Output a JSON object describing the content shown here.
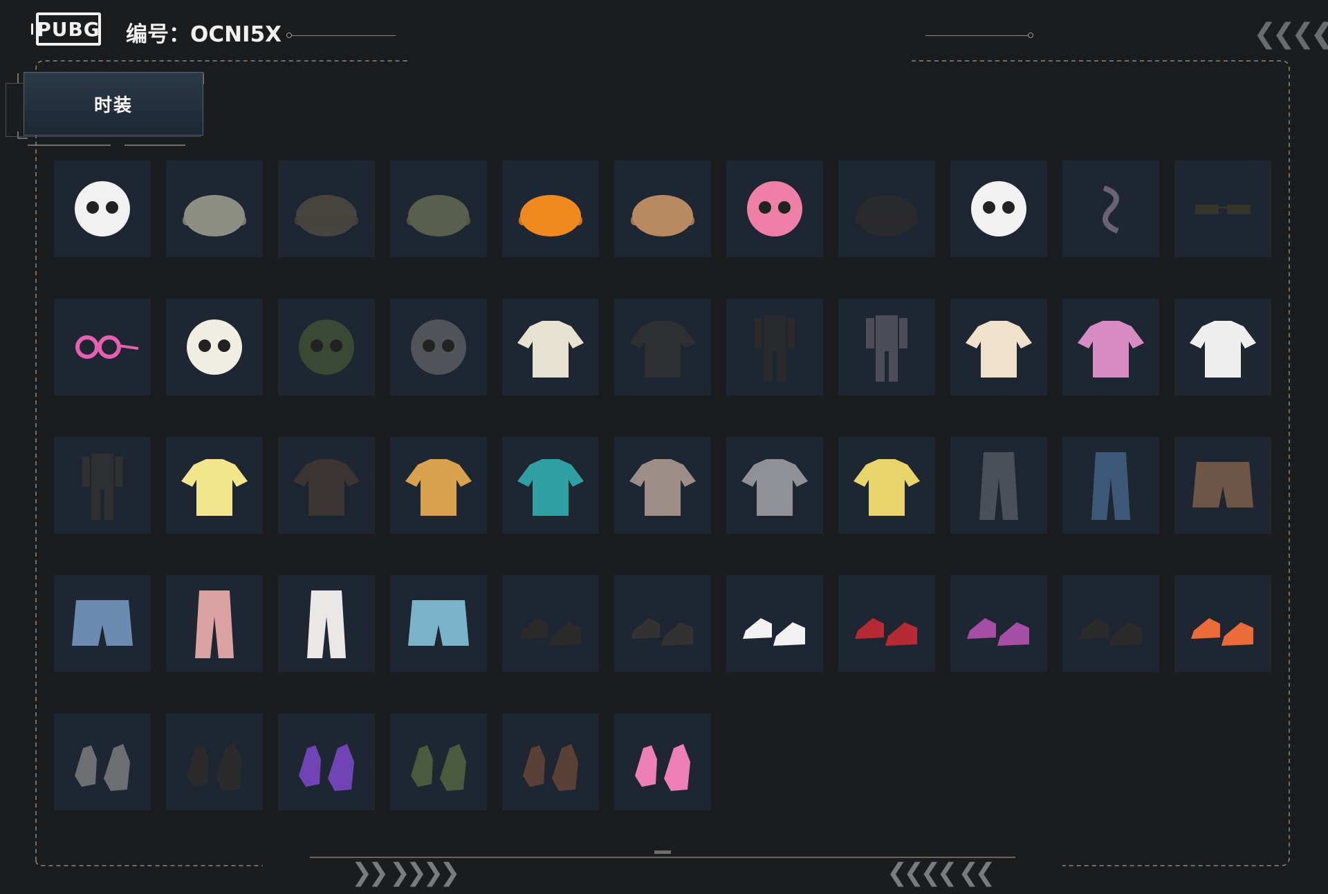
{
  "header": {
    "logo_text": "PUBG",
    "id_text": "编号：OCNI5X"
  },
  "tab": {
    "label": "时装"
  },
  "items": [
    {
      "name": "skull-mask",
      "color": "#f1f1f1"
    },
    {
      "name": "bunny-helmet",
      "color": "#8d8f84"
    },
    {
      "name": "camo-cap",
      "color": "#46443f"
    },
    {
      "name": "headset-cap",
      "color": "#5a5e4c"
    },
    {
      "name": "orange-beanie",
      "color": "#f08a1e"
    },
    {
      "name": "bucket-hat",
      "color": "#b98a62"
    },
    {
      "name": "donut-mask",
      "color": "#ee7fa6"
    },
    {
      "name": "black-cap",
      "color": "#2a2b2e"
    },
    {
      "name": "chicken-mask",
      "color": "#f2f2f2"
    },
    {
      "name": "mask-strap",
      "color": "#6a6272"
    },
    {
      "name": "sunglasses",
      "color": "#34352a"
    },
    {
      "name": "pink-glasses",
      "color": "#e65fb1"
    },
    {
      "name": "neck-pillow",
      "color": "#f0ede2"
    },
    {
      "name": "bandana",
      "color": "#3b4834"
    },
    {
      "name": "face-mask",
      "color": "#505357"
    },
    {
      "name": "tshirt",
      "color": "#e6e2d2"
    },
    {
      "name": "black-vest",
      "color": "#2e2f31"
    },
    {
      "name": "black-outfit",
      "color": "#2a2b2d"
    },
    {
      "name": "baseball-outfit",
      "color": "#4d4d57"
    },
    {
      "name": "crop-top",
      "color": "#f0e0cc"
    },
    {
      "name": "pink-jacket",
      "color": "#d78dc4"
    },
    {
      "name": "snowman-suit",
      "color": "#eeeeee"
    },
    {
      "name": "black-suit",
      "color": "#2e2f31"
    },
    {
      "name": "yellow-tee",
      "color": "#f2e58b"
    },
    {
      "name": "leather-coat",
      "color": "#3a3432"
    },
    {
      "name": "dog-hoodie",
      "color": "#d8a24e"
    },
    {
      "name": "teal-jacket",
      "color": "#2fa1a3"
    },
    {
      "name": "apron-shirt",
      "color": "#9c8e86"
    },
    {
      "name": "moto-jacket",
      "color": "#8f9196"
    },
    {
      "name": "yellow-sweater",
      "color": "#e7d46b"
    },
    {
      "name": "cargo-pants",
      "color": "#4b5058"
    },
    {
      "name": "blue-jeans",
      "color": "#3e5877"
    },
    {
      "name": "leather-shorts",
      "color": "#6e5546"
    },
    {
      "name": "apron-shorts",
      "color": "#6b8bb0"
    },
    {
      "name": "pink-pants",
      "color": "#dca2a2"
    },
    {
      "name": "white-joggers",
      "color": "#eae7e7"
    },
    {
      "name": "denim-shorts",
      "color": "#7ab2c8"
    },
    {
      "name": "black-boots",
      "color": "#2a2a2a"
    },
    {
      "name": "knit-boots",
      "color": "#323232"
    },
    {
      "name": "white-sneakers",
      "color": "#f2f2f2"
    },
    {
      "name": "red-socks-shoes",
      "color": "#b52a33"
    },
    {
      "name": "purple-sneakers",
      "color": "#a44ea6"
    },
    {
      "name": "black-slides",
      "color": "#2b2b2b"
    },
    {
      "name": "orange-sneakers",
      "color": "#ec6b3a"
    },
    {
      "name": "arm-guards",
      "color": "#6c6e72"
    },
    {
      "name": "black-gloves",
      "color": "#2b2b2b"
    },
    {
      "name": "purple-gloves",
      "color": "#7044b4"
    },
    {
      "name": "tactical-gloves",
      "color": "#4a5a3e"
    },
    {
      "name": "fingerless-gloves",
      "color": "#5a4037"
    },
    {
      "name": "pink-gloves",
      "color": "#ef7fb7"
    }
  ]
}
